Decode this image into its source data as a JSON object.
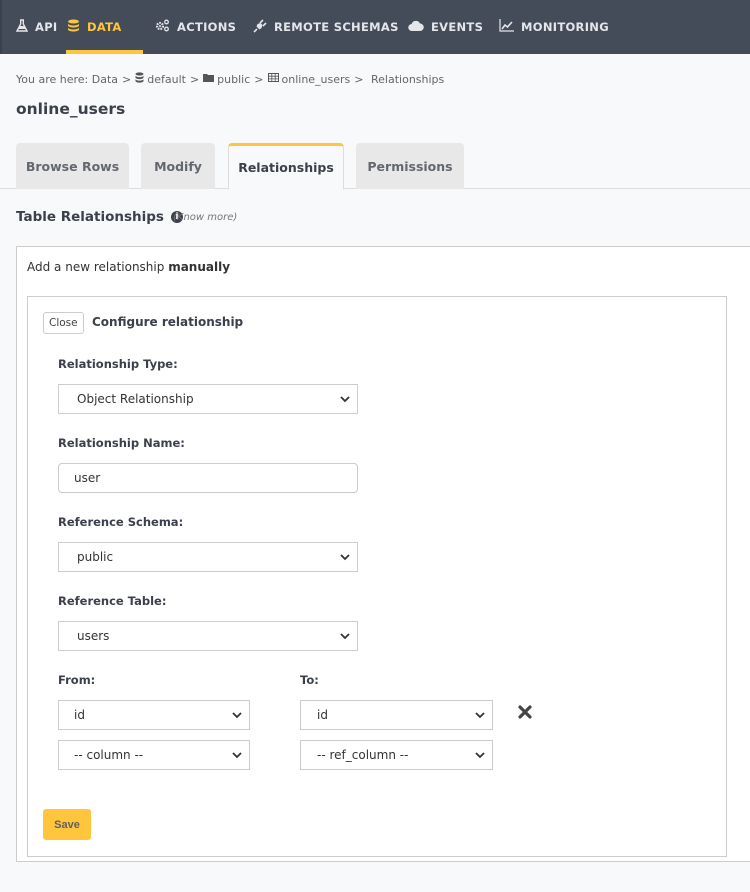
{
  "nav": {
    "items": [
      {
        "label": "API",
        "icon": "flask-icon",
        "glyph": "⚗",
        "active": false
      },
      {
        "label": "DATA",
        "icon": "database-icon",
        "glyph": "≣",
        "active": true
      },
      {
        "label": "ACTIONS",
        "icon": "cogs-icon",
        "glyph": "⚙",
        "active": false
      },
      {
        "label": "REMOTE SCHEMAS",
        "icon": "plug-icon",
        "glyph": "✎",
        "active": false
      },
      {
        "label": "EVENTS",
        "icon": "cloud-icon",
        "glyph": "☁",
        "active": false
      },
      {
        "label": "MONITORING",
        "icon": "line-chart-icon",
        "glyph": "📈",
        "active": false
      }
    ],
    "accent": "#fec53d"
  },
  "breadcrumb": {
    "prefix": "You are here:",
    "items": [
      {
        "label": "Data",
        "icon": null
      },
      {
        "label": "default",
        "icon": "database-icon"
      },
      {
        "label": "public",
        "icon": "folder-icon"
      },
      {
        "label": "online_users",
        "icon": "table-icon"
      },
      {
        "label": "Relationships",
        "icon": null
      }
    ],
    "separator": ">"
  },
  "page": {
    "title": "online_users"
  },
  "tabs": [
    {
      "label": "Browse Rows",
      "active": false
    },
    {
      "label": "Modify",
      "active": false
    },
    {
      "label": "Relationships",
      "active": true
    },
    {
      "label": "Permissions",
      "active": false
    }
  ],
  "section": {
    "title": "Table Relationships",
    "know_more": "(Know more)"
  },
  "add_panel": {
    "heading_prefix": "Add a new relationship",
    "heading_bold": "manually"
  },
  "config": {
    "close_label": "Close",
    "title": "Configure relationship",
    "relationship_type": {
      "label": "Relationship Type:",
      "value": "Object Relationship"
    },
    "relationship_name": {
      "label": "Relationship Name:",
      "value": "user"
    },
    "reference_schema": {
      "label": "Reference Schema:",
      "value": "public"
    },
    "reference_table": {
      "label": "Reference Table:",
      "value": "users"
    },
    "from_label": "From:",
    "to_label": "To:",
    "mappings": [
      {
        "from": "id",
        "to": "id",
        "removable": true
      },
      {
        "from": "-- column --",
        "to": "-- ref_column --",
        "removable": false
      }
    ],
    "save_label": "Save"
  }
}
